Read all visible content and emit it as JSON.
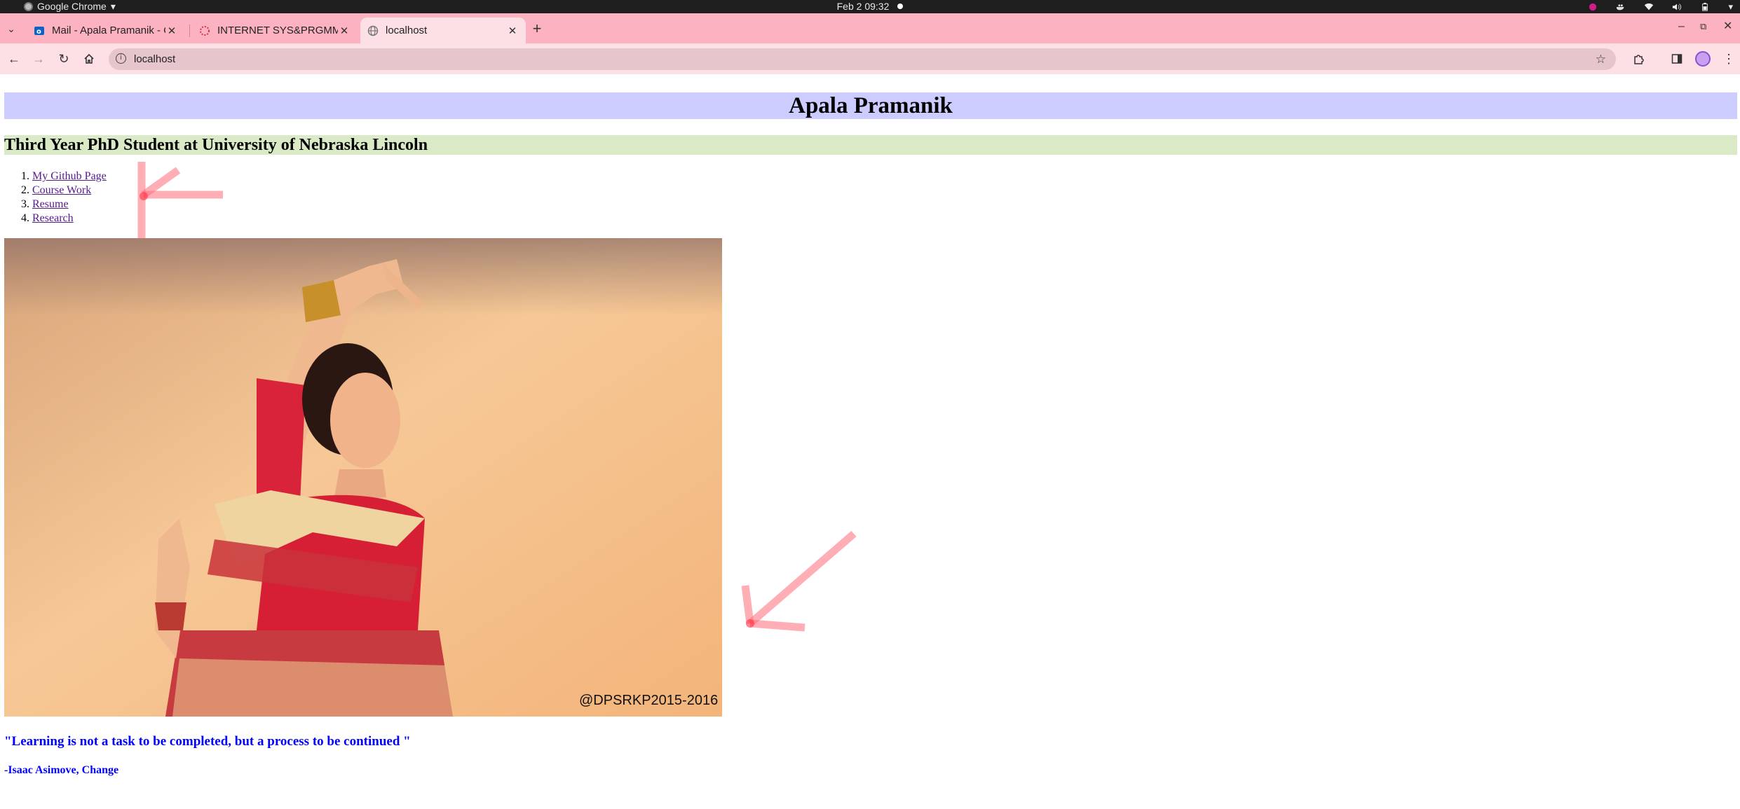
{
  "os_bar": {
    "app_name": "Google Chrome",
    "clock": "Feb 2  09:32"
  },
  "browser": {
    "tabs": [
      {
        "title": "Mail - Apala Pramanik - O",
        "active": false
      },
      {
        "title": "INTERNET SYS&PRGMMI",
        "active": false
      },
      {
        "title": "localhost",
        "active": true
      }
    ],
    "address": "localhost",
    "icons": {
      "back": "arrow-left-icon",
      "forward": "arrow-right-icon",
      "reload": "reload-icon",
      "home": "home-icon",
      "bookmark": "star-icon",
      "extensions": "puzzle-icon",
      "side_panel": "side-panel-icon",
      "menu": "kebab-menu-icon"
    }
  },
  "page": {
    "heading": "Apala Pramanik",
    "subheading": "Third Year PhD Student at University of Nebraska Lincoln",
    "links": [
      "My Github Page",
      "Course Work",
      "Resume",
      "Research"
    ],
    "photo_watermark": "@DPSRKP2015-2016",
    "quote": "\"Learning is not a task to be completed, but a process to be continued \"",
    "author": "-Isaac Asimove, Change"
  },
  "colors": {
    "heading_bg": "#ccccff",
    "subheading_bg": "#dbeac6",
    "quote_color": "#0000ff",
    "tab_bar_bg": "#fcb2c1",
    "toolbar_bg": "#fde0e6",
    "annotation_arrow": "#ff6b7a"
  }
}
